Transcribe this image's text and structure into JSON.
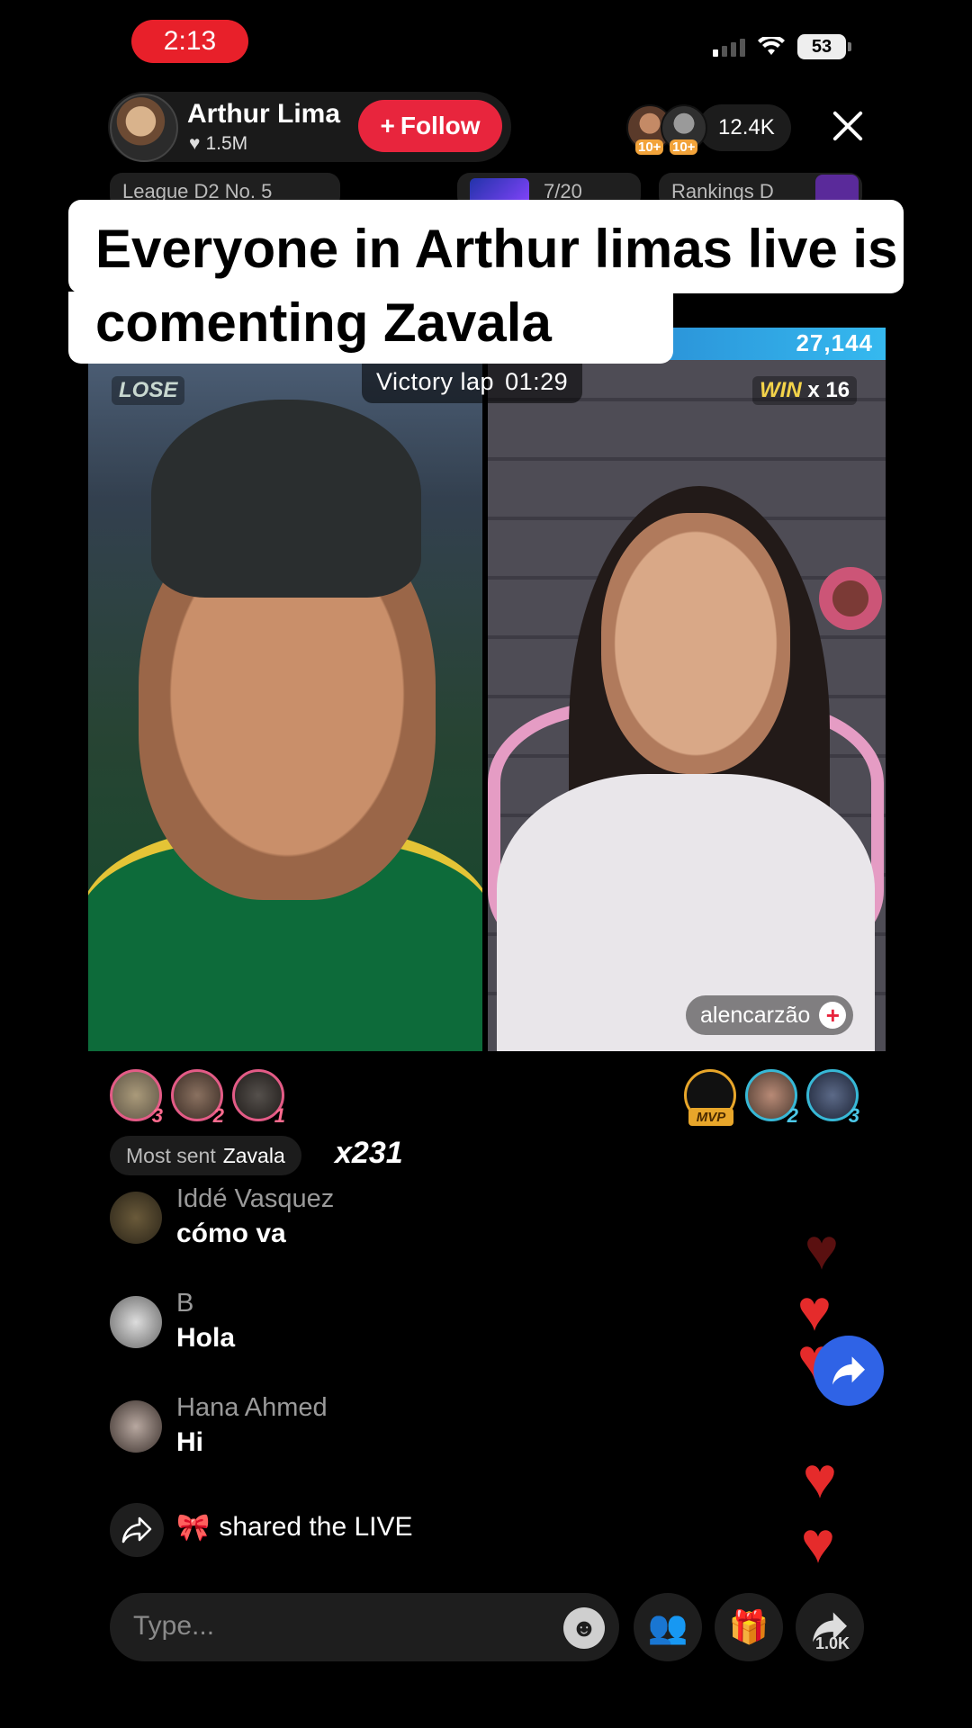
{
  "status_bar": {
    "time": "2:13",
    "battery": "53"
  },
  "host": {
    "name": "Arthur Lima",
    "likes": "1.5M",
    "follow_label": "Follow"
  },
  "viewers": {
    "badge_1": "10+",
    "badge_2": "10+",
    "count": "12.4K"
  },
  "chips": {
    "league": "League D2 No. 5",
    "progress": "7/20",
    "rankings": "Rankings D"
  },
  "caption": "Everyone in Arthur limas live is comenting Zavala",
  "battle": {
    "score": "27,144",
    "left_result": "LOSE",
    "timer_label": "Victory lap",
    "timer": "01:29",
    "right_result": "WIN",
    "win_streak": "x 16",
    "guest_name": "alencarzão"
  },
  "gifters_left": [
    {
      "rank": "3"
    },
    {
      "rank": "2"
    },
    {
      "rank": "1"
    }
  ],
  "gifters_right": [
    {
      "rank": "MVP"
    },
    {
      "rank": "2"
    },
    {
      "rank": "3"
    }
  ],
  "most_sent": {
    "label": "Most sent",
    "gifter": "Zavala",
    "count": "x231"
  },
  "chat": [
    {
      "user": "Iddé Vasquez",
      "message": "cómo va"
    },
    {
      "user": "B",
      "message": "Hola"
    },
    {
      "user": "Hana Ahmed",
      "message": "Hi"
    }
  ],
  "shared": {
    "emoji": "🎀",
    "text": "shared the LIVE"
  },
  "input": {
    "placeholder": "Type..."
  },
  "share_count": "1.0K",
  "colors": {
    "accent_red": "#e8253d",
    "score_blue": "#35b9ef",
    "win_gold": "#f3d34a",
    "share_fab": "#2f63e6"
  }
}
